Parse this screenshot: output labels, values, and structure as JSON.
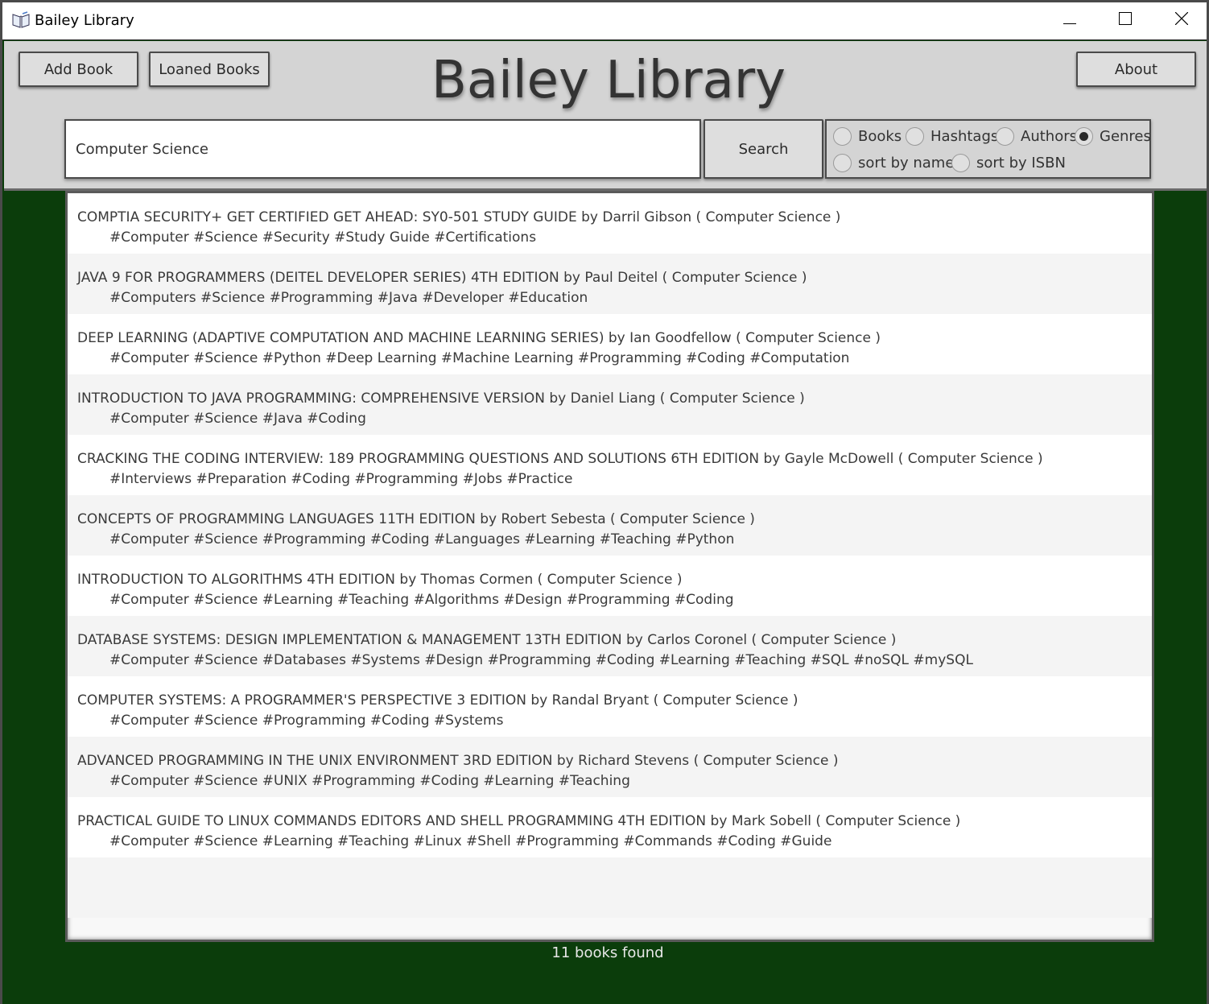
{
  "window": {
    "title": "Bailey Library"
  },
  "toolbar": {
    "add_book": "Add Book",
    "loaned_books": "Loaned Books",
    "about": "About"
  },
  "heading": "Bailey Library",
  "search": {
    "value": "Computer Science",
    "button": "Search"
  },
  "options": {
    "books": "Books",
    "hashtags": "Hashtags",
    "authors": "Authors",
    "genres": "Genres",
    "sort_by_name": "sort by name",
    "sort_by_isbn": "sort by ISBN",
    "selected": "Genres"
  },
  "results": [
    {
      "title": "COMPTIA SECURITY+ GET CERTIFIED GET AHEAD: SY0-501 STUDY GUIDE by Darril Gibson ( Computer Science )",
      "tags": "#Computer #Science #Security #Study Guide #Certifications"
    },
    {
      "title": "JAVA 9 FOR PROGRAMMERS (DEITEL DEVELOPER SERIES) 4TH EDITION by Paul Deitel ( Computer Science )",
      "tags": "#Computers #Science #Programming #Java #Developer #Education"
    },
    {
      "title": "DEEP LEARNING (ADAPTIVE COMPUTATION AND MACHINE LEARNING SERIES) by Ian Goodfellow ( Computer Science )",
      "tags": "#Computer #Science #Python #Deep Learning #Machine Learning #Programming #Coding #Computation"
    },
    {
      "title": "INTRODUCTION TO JAVA PROGRAMMING: COMPREHENSIVE VERSION by Daniel Liang ( Computer Science )",
      "tags": "#Computer #Science #Java #Coding"
    },
    {
      "title": "CRACKING THE CODING INTERVIEW: 189 PROGRAMMING QUESTIONS AND SOLUTIONS 6TH EDITION by Gayle McDowell ( Computer Science )",
      "tags": "#Interviews #Preparation #Coding #Programming #Jobs #Practice"
    },
    {
      "title": "CONCEPTS OF PROGRAMMING LANGUAGES 11TH EDITION by Robert Sebesta ( Computer Science )",
      "tags": "#Computer #Science #Programming #Coding #Languages #Learning #Teaching #Python"
    },
    {
      "title": "INTRODUCTION TO ALGORITHMS 4TH EDITION by Thomas Cormen ( Computer Science )",
      "tags": "#Computer #Science #Learning #Teaching #Algorithms #Design #Programming #Coding"
    },
    {
      "title": "DATABASE SYSTEMS: DESIGN IMPLEMENTATION & MANAGEMENT 13TH EDITION by Carlos Coronel ( Computer Science )",
      "tags": "#Computer #Science #Databases #Systems #Design #Programming #Coding #Learning #Teaching #SQL #noSQL #mySQL"
    },
    {
      "title": "COMPUTER SYSTEMS: A PROGRAMMER'S PERSPECTIVE 3 EDITION by Randal Bryant ( Computer Science )",
      "tags": "#Computer #Science #Programming #Coding #Systems"
    },
    {
      "title": "ADVANCED PROGRAMMING IN THE UNIX ENVIRONMENT 3RD EDITION by Richard Stevens ( Computer Science )",
      "tags": "#Computer #Science #UNIX #Programming #Coding #Learning #Teaching"
    },
    {
      "title": "PRACTICAL GUIDE TO LINUX COMMANDS EDITORS AND SHELL PROGRAMMING 4TH EDITION by Mark Sobell ( Computer Science )",
      "tags": "#Computer #Science #Learning #Teaching #Linux #Shell #Programming #Commands #Coding #Guide"
    }
  ],
  "status": "11 books found",
  "icons": {
    "app": "book-icon",
    "minimize": "minimize-icon",
    "maximize": "maximize-icon",
    "close": "close-icon"
  },
  "colors": {
    "background": "#0b3d0b",
    "header": "#d4d4d4"
  }
}
